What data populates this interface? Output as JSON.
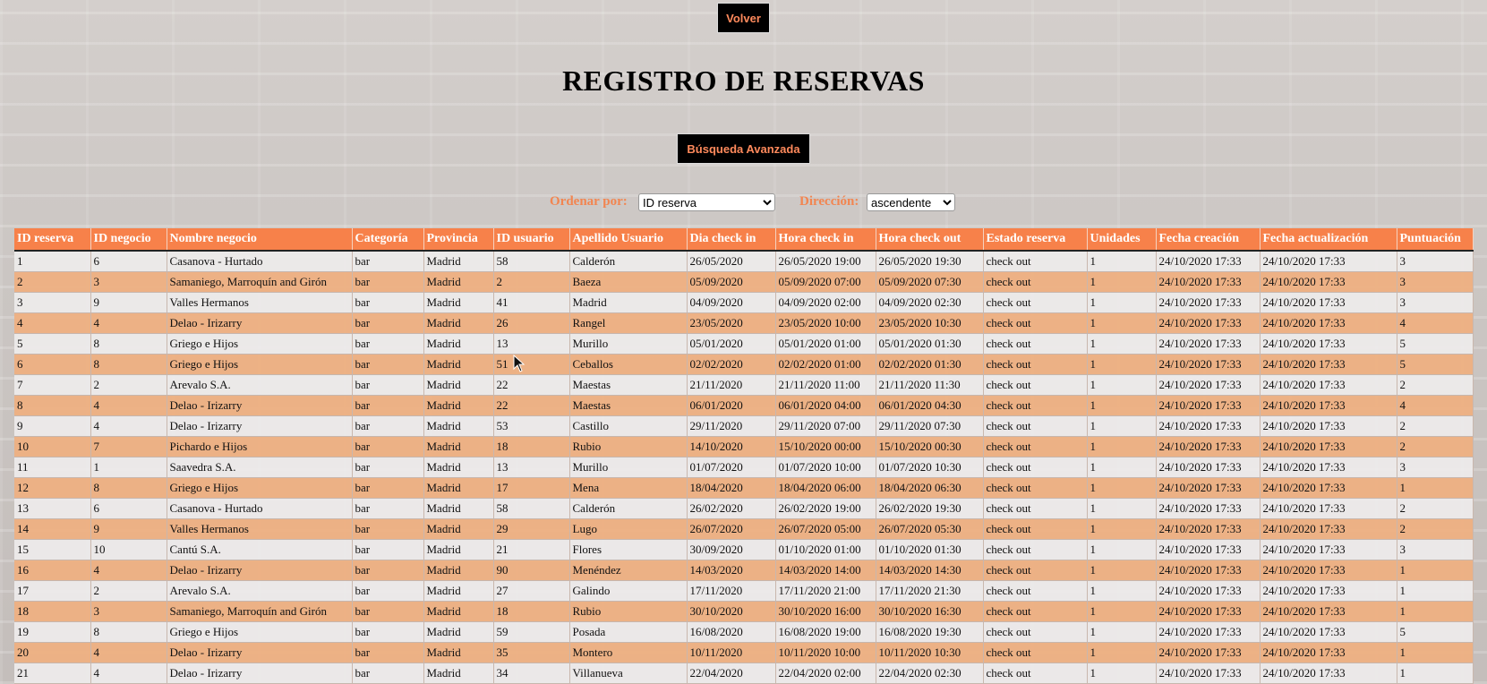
{
  "nav": {
    "back_label": "Volver"
  },
  "page": {
    "title": "REGISTRO DE RESERVAS",
    "advanced_search_label": "Búsqueda Avanzada"
  },
  "sort": {
    "order_label": "Ordenar por:",
    "order_value": "ID reserva",
    "direction_label": "Dirección:",
    "direction_value": "ascendente"
  },
  "colors": {
    "accent": "#f7814a",
    "button_bg": "#000000",
    "row_alt": "#eeb082"
  },
  "icons": [
    "chevron-down-icon",
    "mouse-cursor-icon"
  ],
  "table": {
    "columns": [
      "ID reserva",
      "ID negocio",
      "Nombre negocio",
      "Categoría",
      "Provincia",
      "ID usuario",
      "Apellido Usuario",
      "Dia check in",
      "Hora check in",
      "Hora check out",
      "Estado reserva",
      "Unidades",
      "Fecha creación",
      "Fecha actualización",
      "Puntuación"
    ],
    "rows": [
      [
        "1",
        "6",
        "Casanova - Hurtado",
        "bar",
        "Madrid",
        "58",
        "Calderón",
        "26/05/2020",
        "26/05/2020 19:00",
        "26/05/2020 19:30",
        "check out",
        "1",
        "24/10/2020 17:33",
        "24/10/2020 17:33",
        "3"
      ],
      [
        "2",
        "3",
        "Samaniego, Marroquín and Girón",
        "bar",
        "Madrid",
        "2",
        "Baeza",
        "05/09/2020",
        "05/09/2020 07:00",
        "05/09/2020 07:30",
        "check out",
        "1",
        "24/10/2020 17:33",
        "24/10/2020 17:33",
        "3"
      ],
      [
        "3",
        "9",
        "Valles Hermanos",
        "bar",
        "Madrid",
        "41",
        "Madrid",
        "04/09/2020",
        "04/09/2020 02:00",
        "04/09/2020 02:30",
        "check out",
        "1",
        "24/10/2020 17:33",
        "24/10/2020 17:33",
        "3"
      ],
      [
        "4",
        "4",
        "Delao - Irizarry",
        "bar",
        "Madrid",
        "26",
        "Rangel",
        "23/05/2020",
        "23/05/2020 10:00",
        "23/05/2020 10:30",
        "check out",
        "1",
        "24/10/2020 17:33",
        "24/10/2020 17:33",
        "4"
      ],
      [
        "5",
        "8",
        "Griego e Hijos",
        "bar",
        "Madrid",
        "13",
        "Murillo",
        "05/01/2020",
        "05/01/2020 01:00",
        "05/01/2020 01:30",
        "check out",
        "1",
        "24/10/2020 17:33",
        "24/10/2020 17:33",
        "5"
      ],
      [
        "6",
        "8",
        "Griego e Hijos",
        "bar",
        "Madrid",
        "51",
        "Ceballos",
        "02/02/2020",
        "02/02/2020 01:00",
        "02/02/2020 01:30",
        "check out",
        "1",
        "24/10/2020 17:33",
        "24/10/2020 17:33",
        "5"
      ],
      [
        "7",
        "2",
        "Arevalo S.A.",
        "bar",
        "Madrid",
        "22",
        "Maestas",
        "21/11/2020",
        "21/11/2020 11:00",
        "21/11/2020 11:30",
        "check out",
        "1",
        "24/10/2020 17:33",
        "24/10/2020 17:33",
        "2"
      ],
      [
        "8",
        "4",
        "Delao - Irizarry",
        "bar",
        "Madrid",
        "22",
        "Maestas",
        "06/01/2020",
        "06/01/2020 04:00",
        "06/01/2020 04:30",
        "check out",
        "1",
        "24/10/2020 17:33",
        "24/10/2020 17:33",
        "4"
      ],
      [
        "9",
        "4",
        "Delao - Irizarry",
        "bar",
        "Madrid",
        "53",
        "Castillo",
        "29/11/2020",
        "29/11/2020 07:00",
        "29/11/2020 07:30",
        "check out",
        "1",
        "24/10/2020 17:33",
        "24/10/2020 17:33",
        "2"
      ],
      [
        "10",
        "7",
        "Pichardo e Hijos",
        "bar",
        "Madrid",
        "18",
        "Rubio",
        "14/10/2020",
        "15/10/2020 00:00",
        "15/10/2020 00:30",
        "check out",
        "1",
        "24/10/2020 17:33",
        "24/10/2020 17:33",
        "2"
      ],
      [
        "11",
        "1",
        "Saavedra S.A.",
        "bar",
        "Madrid",
        "13",
        "Murillo",
        "01/07/2020",
        "01/07/2020 10:00",
        "01/07/2020 10:30",
        "check out",
        "1",
        "24/10/2020 17:33",
        "24/10/2020 17:33",
        "3"
      ],
      [
        "12",
        "8",
        "Griego e Hijos",
        "bar",
        "Madrid",
        "17",
        "Mena",
        "18/04/2020",
        "18/04/2020 06:00",
        "18/04/2020 06:30",
        "check out",
        "1",
        "24/10/2020 17:33",
        "24/10/2020 17:33",
        "1"
      ],
      [
        "13",
        "6",
        "Casanova - Hurtado",
        "bar",
        "Madrid",
        "58",
        "Calderón",
        "26/02/2020",
        "26/02/2020 19:00",
        "26/02/2020 19:30",
        "check out",
        "1",
        "24/10/2020 17:33",
        "24/10/2020 17:33",
        "2"
      ],
      [
        "14",
        "9",
        "Valles Hermanos",
        "bar",
        "Madrid",
        "29",
        "Lugo",
        "26/07/2020",
        "26/07/2020 05:00",
        "26/07/2020 05:30",
        "check out",
        "1",
        "24/10/2020 17:33",
        "24/10/2020 17:33",
        "2"
      ],
      [
        "15",
        "10",
        "Cantú S.A.",
        "bar",
        "Madrid",
        "21",
        "Flores",
        "30/09/2020",
        "01/10/2020 01:00",
        "01/10/2020 01:30",
        "check out",
        "1",
        "24/10/2020 17:33",
        "24/10/2020 17:33",
        "3"
      ],
      [
        "16",
        "4",
        "Delao - Irizarry",
        "bar",
        "Madrid",
        "90",
        "Menéndez",
        "14/03/2020",
        "14/03/2020 14:00",
        "14/03/2020 14:30",
        "check out",
        "1",
        "24/10/2020 17:33",
        "24/10/2020 17:33",
        "1"
      ],
      [
        "17",
        "2",
        "Arevalo S.A.",
        "bar",
        "Madrid",
        "27",
        "Galindo",
        "17/11/2020",
        "17/11/2020 21:00",
        "17/11/2020 21:30",
        "check out",
        "1",
        "24/10/2020 17:33",
        "24/10/2020 17:33",
        "1"
      ],
      [
        "18",
        "3",
        "Samaniego, Marroquín and Girón",
        "bar",
        "Madrid",
        "18",
        "Rubio",
        "30/10/2020",
        "30/10/2020 16:00",
        "30/10/2020 16:30",
        "check out",
        "1",
        "24/10/2020 17:33",
        "24/10/2020 17:33",
        "1"
      ],
      [
        "19",
        "8",
        "Griego e Hijos",
        "bar",
        "Madrid",
        "59",
        "Posada",
        "16/08/2020",
        "16/08/2020 19:00",
        "16/08/2020 19:30",
        "check out",
        "1",
        "24/10/2020 17:33",
        "24/10/2020 17:33",
        "5"
      ],
      [
        "20",
        "4",
        "Delao - Irizarry",
        "bar",
        "Madrid",
        "35",
        "Montero",
        "10/11/2020",
        "10/11/2020 10:00",
        "10/11/2020 10:30",
        "check out",
        "1",
        "24/10/2020 17:33",
        "24/10/2020 17:33",
        "1"
      ],
      [
        "21",
        "4",
        "Delao - Irizarry",
        "bar",
        "Madrid",
        "34",
        "Villanueva",
        "22/04/2020",
        "22/04/2020 02:00",
        "22/04/2020 02:30",
        "check out",
        "1",
        "24/10/2020 17:33",
        "24/10/2020 17:33",
        "1"
      ]
    ]
  }
}
